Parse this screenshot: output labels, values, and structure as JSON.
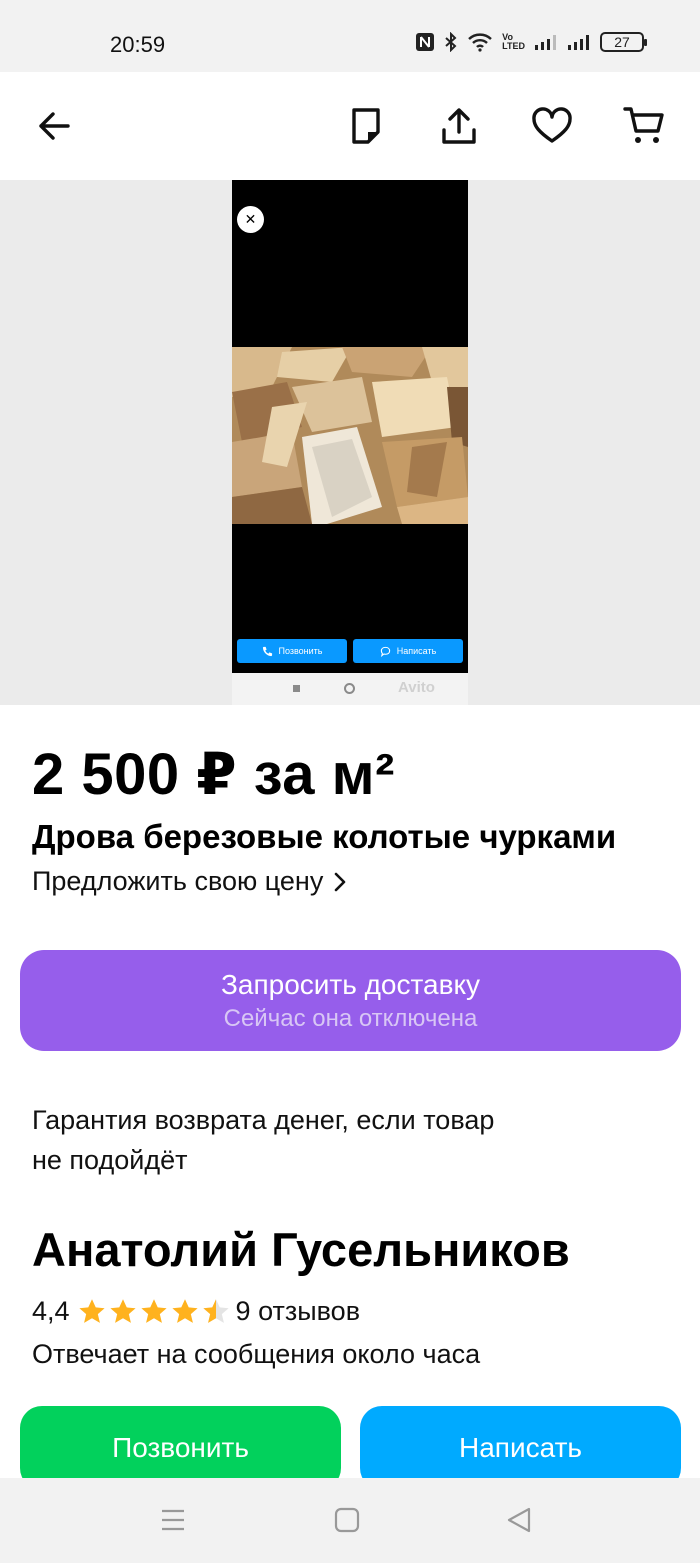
{
  "status_bar": {
    "time": "20:59",
    "battery": "27",
    "network_label_top": "Vo",
    "network_label_bottom": "LTED"
  },
  "app_bar": {
    "back_icon": "arrow-left-icon",
    "icons": [
      "note-icon",
      "share-icon",
      "heart-icon",
      "cart-icon"
    ]
  },
  "gallery": {
    "screenshot_buttons": {
      "call": "Позвонить",
      "write": "Написать"
    },
    "watermark": "Avito"
  },
  "listing": {
    "price": "2 500 ₽ за м²",
    "title": "Дрова березовые колотые чурками",
    "offer_price": "Предложить свою цену"
  },
  "delivery": {
    "label": "Запросить доставку",
    "status": "Сейчас она отключена"
  },
  "guarantee": {
    "line1": "Гарантия возврата денег, если товар",
    "line2": "не подойдёт"
  },
  "seller": {
    "name": "Анатолий Гусельников",
    "rating": "4,4",
    "rating_value": 4.4,
    "reviews": "9 отзывов",
    "response_time": "Отвечает на сообщения около часа"
  },
  "actions": {
    "call": "Позвонить",
    "write": "Написать"
  },
  "colors": {
    "delivery_button": "#965eeb",
    "call_button": "#02d15c",
    "write_button": "#00aaff",
    "star": "#ffb21e"
  }
}
